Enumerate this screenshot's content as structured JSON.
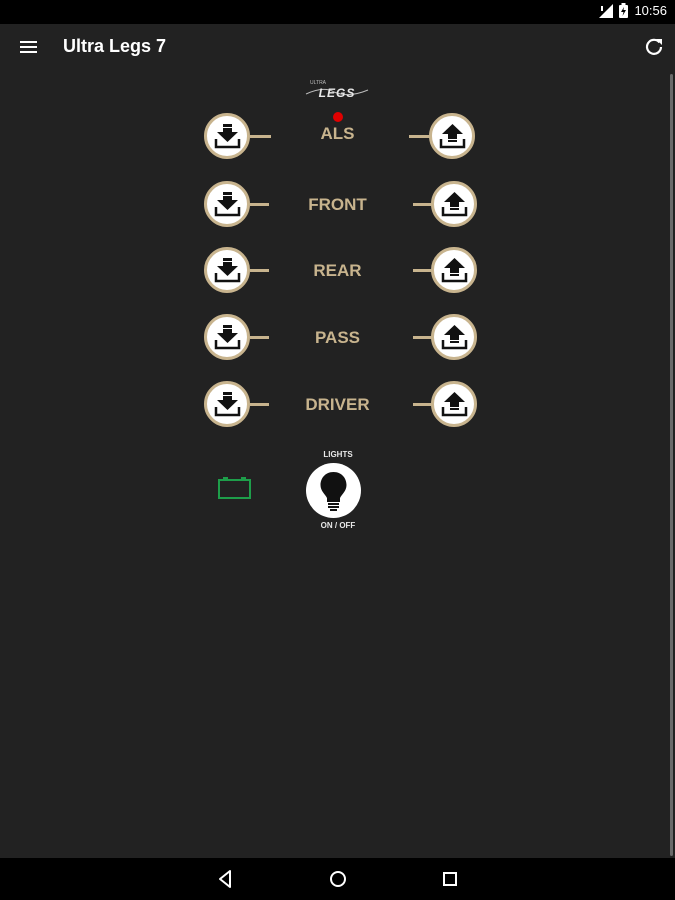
{
  "status_bar": {
    "time": "10:56"
  },
  "app_bar": {
    "title": "Ultra Legs 7"
  },
  "logo": {
    "main": "LEGS",
    "small": "ULTRA"
  },
  "colors": {
    "accent": "#c8b48e",
    "background": "#222222",
    "indicator": "#e00000",
    "battery": "#1e9e4a"
  },
  "controls": {
    "rows": [
      {
        "label": "ALS"
      },
      {
        "label": "FRONT"
      },
      {
        "label": "REAR"
      },
      {
        "label": "PASS"
      },
      {
        "label": "DRIVER"
      }
    ],
    "lights_label": "LIGHTS",
    "on_off_label": "ON / OFF"
  },
  "icons": {
    "down": "arrow-down-tray-icon",
    "up": "arrow-up-tray-icon",
    "light": "light-bulb-icon",
    "battery": "battery-icon"
  }
}
